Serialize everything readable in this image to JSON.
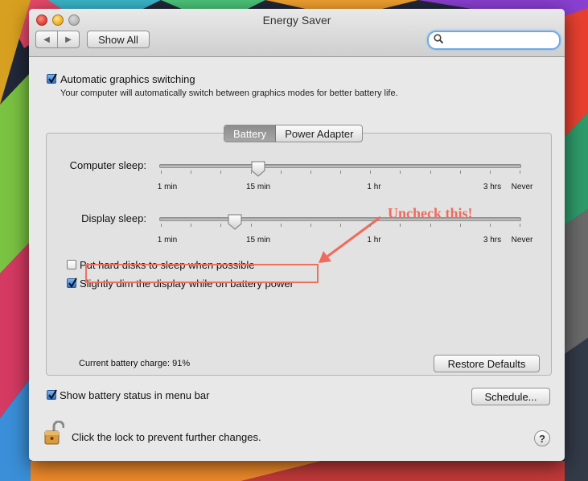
{
  "window": {
    "title": "Energy Saver"
  },
  "toolbar": {
    "back_icon": "back-arrow-icon",
    "forward_icon": "forward-arrow-icon",
    "show_all_label": "Show All",
    "search_value": "",
    "search_placeholder": ""
  },
  "graphics": {
    "checkbox_label": "Automatic graphics switching",
    "checked": true,
    "description": "Your computer will automatically switch between graphics modes for better battery life."
  },
  "tabs": [
    {
      "label": "Battery",
      "selected": true
    },
    {
      "label": "Power Adapter",
      "selected": false
    }
  ],
  "sliders": {
    "computer_sleep": {
      "label": "Computer sleep:",
      "value": "15 min",
      "ticks": [
        "1 min",
        "15 min",
        "1 hr",
        "3 hrs",
        "Never"
      ]
    },
    "display_sleep": {
      "label": "Display sleep:",
      "value": "10 min",
      "ticks": [
        "1 min",
        "15 min",
        "1 hr",
        "3 hrs",
        "Never"
      ]
    }
  },
  "options": {
    "hard_disks": {
      "label": "Put hard disks to sleep when possible",
      "checked": false
    },
    "dim_display": {
      "label": "Slightly dim the display while on battery power",
      "checked": true
    }
  },
  "annotation": {
    "text": "Uncheck this!",
    "color": "#ef6b5c"
  },
  "battery": {
    "charge_text": "Current battery charge: 91%"
  },
  "buttons": {
    "restore_defaults": "Restore Defaults",
    "schedule": "Schedule..."
  },
  "menu_bar_status": {
    "label": "Show battery status in menu bar",
    "checked": true
  },
  "lock": {
    "label": "Click the lock to prevent further changes.",
    "icon": "unlocked-padlock-icon"
  },
  "help": {
    "label": "?"
  }
}
